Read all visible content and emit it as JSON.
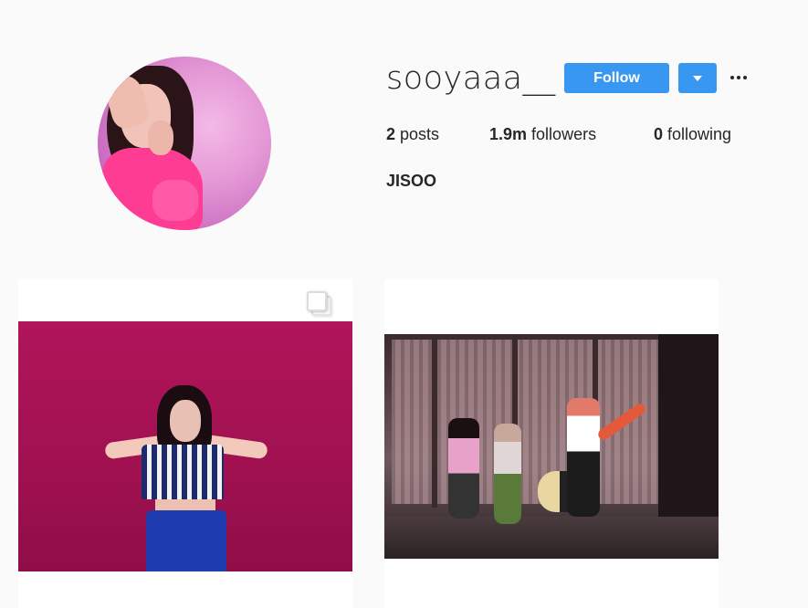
{
  "profile": {
    "username": "sooyaaa__",
    "follow_label": "Follow",
    "full_name": "JISOO",
    "stats": {
      "posts_count": "2",
      "posts_label": "posts",
      "followers_count": "1.9m",
      "followers_label": "followers",
      "following_count": "0",
      "following_label": "following"
    }
  },
  "icons": {
    "dropdown": "caret-down-icon",
    "more": "more-horizontal-icon",
    "multi_post": "carousel-icon"
  },
  "colors": {
    "accent": "#3897f0",
    "background": "#fafafa",
    "text": "#262626"
  }
}
